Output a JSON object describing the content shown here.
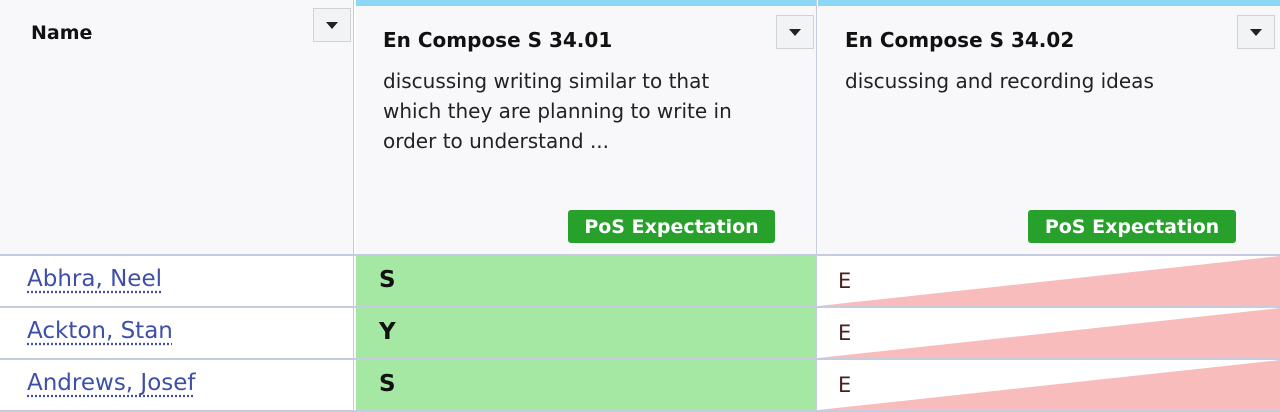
{
  "table": {
    "name_header": "Name",
    "columns": [
      {
        "code": "En Compose S 34.01",
        "description": "discussing writing similar to that which they are planning to write in order to understand ...",
        "badge": "PoS Expectation"
      },
      {
        "code": "En Compose S 34.02",
        "description": "discussing and recording ideas",
        "badge": "PoS Expectation"
      }
    ],
    "rows": [
      {
        "name": "Abhra, Neel",
        "col1": "S",
        "col2": "E"
      },
      {
        "name": "Ackton, Stan",
        "col1": "Y",
        "col2": "E"
      },
      {
        "name": "Andrews, Josef",
        "col1": "S",
        "col2": "E"
      }
    ]
  },
  "colors": {
    "header_accent": "#8ad8f5",
    "badge_green": "#27a02c",
    "cell_green": "#a4e8a3",
    "cell_red": "#f8bcbc",
    "link": "#3e4fa8"
  },
  "icons": {
    "dropdown": "chevron-down-icon"
  }
}
